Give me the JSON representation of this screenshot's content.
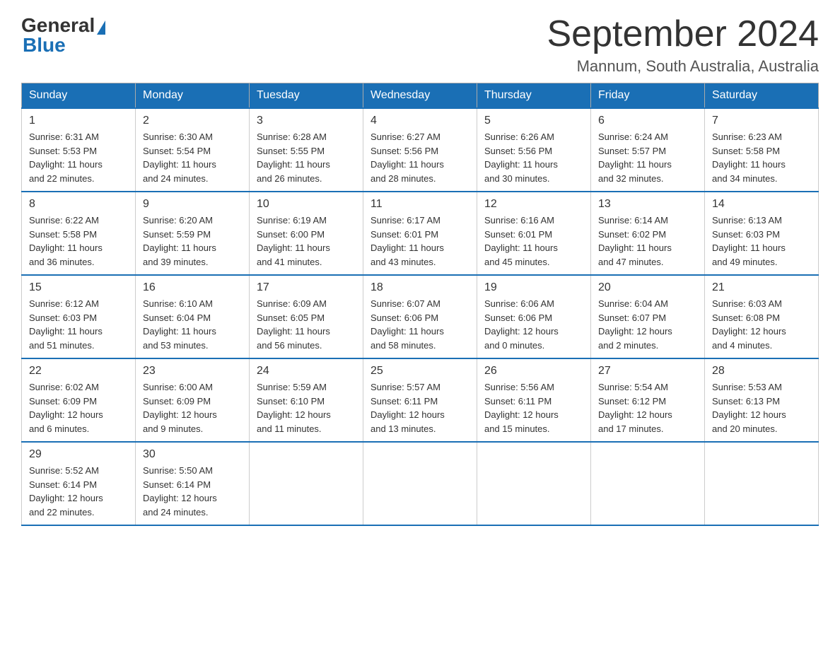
{
  "logo": {
    "general": "General",
    "blue": "Blue"
  },
  "title": "September 2024",
  "location": "Mannum, South Australia, Australia",
  "days_of_week": [
    "Sunday",
    "Monday",
    "Tuesday",
    "Wednesday",
    "Thursday",
    "Friday",
    "Saturday"
  ],
  "weeks": [
    [
      {
        "day": "1",
        "info": "Sunrise: 6:31 AM\nSunset: 5:53 PM\nDaylight: 11 hours\nand 22 minutes."
      },
      {
        "day": "2",
        "info": "Sunrise: 6:30 AM\nSunset: 5:54 PM\nDaylight: 11 hours\nand 24 minutes."
      },
      {
        "day": "3",
        "info": "Sunrise: 6:28 AM\nSunset: 5:55 PM\nDaylight: 11 hours\nand 26 minutes."
      },
      {
        "day": "4",
        "info": "Sunrise: 6:27 AM\nSunset: 5:56 PM\nDaylight: 11 hours\nand 28 minutes."
      },
      {
        "day": "5",
        "info": "Sunrise: 6:26 AM\nSunset: 5:56 PM\nDaylight: 11 hours\nand 30 minutes."
      },
      {
        "day": "6",
        "info": "Sunrise: 6:24 AM\nSunset: 5:57 PM\nDaylight: 11 hours\nand 32 minutes."
      },
      {
        "day": "7",
        "info": "Sunrise: 6:23 AM\nSunset: 5:58 PM\nDaylight: 11 hours\nand 34 minutes."
      }
    ],
    [
      {
        "day": "8",
        "info": "Sunrise: 6:22 AM\nSunset: 5:58 PM\nDaylight: 11 hours\nand 36 minutes."
      },
      {
        "day": "9",
        "info": "Sunrise: 6:20 AM\nSunset: 5:59 PM\nDaylight: 11 hours\nand 39 minutes."
      },
      {
        "day": "10",
        "info": "Sunrise: 6:19 AM\nSunset: 6:00 PM\nDaylight: 11 hours\nand 41 minutes."
      },
      {
        "day": "11",
        "info": "Sunrise: 6:17 AM\nSunset: 6:01 PM\nDaylight: 11 hours\nand 43 minutes."
      },
      {
        "day": "12",
        "info": "Sunrise: 6:16 AM\nSunset: 6:01 PM\nDaylight: 11 hours\nand 45 minutes."
      },
      {
        "day": "13",
        "info": "Sunrise: 6:14 AM\nSunset: 6:02 PM\nDaylight: 11 hours\nand 47 minutes."
      },
      {
        "day": "14",
        "info": "Sunrise: 6:13 AM\nSunset: 6:03 PM\nDaylight: 11 hours\nand 49 minutes."
      }
    ],
    [
      {
        "day": "15",
        "info": "Sunrise: 6:12 AM\nSunset: 6:03 PM\nDaylight: 11 hours\nand 51 minutes."
      },
      {
        "day": "16",
        "info": "Sunrise: 6:10 AM\nSunset: 6:04 PM\nDaylight: 11 hours\nand 53 minutes."
      },
      {
        "day": "17",
        "info": "Sunrise: 6:09 AM\nSunset: 6:05 PM\nDaylight: 11 hours\nand 56 minutes."
      },
      {
        "day": "18",
        "info": "Sunrise: 6:07 AM\nSunset: 6:06 PM\nDaylight: 11 hours\nand 58 minutes."
      },
      {
        "day": "19",
        "info": "Sunrise: 6:06 AM\nSunset: 6:06 PM\nDaylight: 12 hours\nand 0 minutes."
      },
      {
        "day": "20",
        "info": "Sunrise: 6:04 AM\nSunset: 6:07 PM\nDaylight: 12 hours\nand 2 minutes."
      },
      {
        "day": "21",
        "info": "Sunrise: 6:03 AM\nSunset: 6:08 PM\nDaylight: 12 hours\nand 4 minutes."
      }
    ],
    [
      {
        "day": "22",
        "info": "Sunrise: 6:02 AM\nSunset: 6:09 PM\nDaylight: 12 hours\nand 6 minutes."
      },
      {
        "day": "23",
        "info": "Sunrise: 6:00 AM\nSunset: 6:09 PM\nDaylight: 12 hours\nand 9 minutes."
      },
      {
        "day": "24",
        "info": "Sunrise: 5:59 AM\nSunset: 6:10 PM\nDaylight: 12 hours\nand 11 minutes."
      },
      {
        "day": "25",
        "info": "Sunrise: 5:57 AM\nSunset: 6:11 PM\nDaylight: 12 hours\nand 13 minutes."
      },
      {
        "day": "26",
        "info": "Sunrise: 5:56 AM\nSunset: 6:11 PM\nDaylight: 12 hours\nand 15 minutes."
      },
      {
        "day": "27",
        "info": "Sunrise: 5:54 AM\nSunset: 6:12 PM\nDaylight: 12 hours\nand 17 minutes."
      },
      {
        "day": "28",
        "info": "Sunrise: 5:53 AM\nSunset: 6:13 PM\nDaylight: 12 hours\nand 20 minutes."
      }
    ],
    [
      {
        "day": "29",
        "info": "Sunrise: 5:52 AM\nSunset: 6:14 PM\nDaylight: 12 hours\nand 22 minutes."
      },
      {
        "day": "30",
        "info": "Sunrise: 5:50 AM\nSunset: 6:14 PM\nDaylight: 12 hours\nand 24 minutes."
      },
      {
        "day": "",
        "info": ""
      },
      {
        "day": "",
        "info": ""
      },
      {
        "day": "",
        "info": ""
      },
      {
        "day": "",
        "info": ""
      },
      {
        "day": "",
        "info": ""
      }
    ]
  ]
}
